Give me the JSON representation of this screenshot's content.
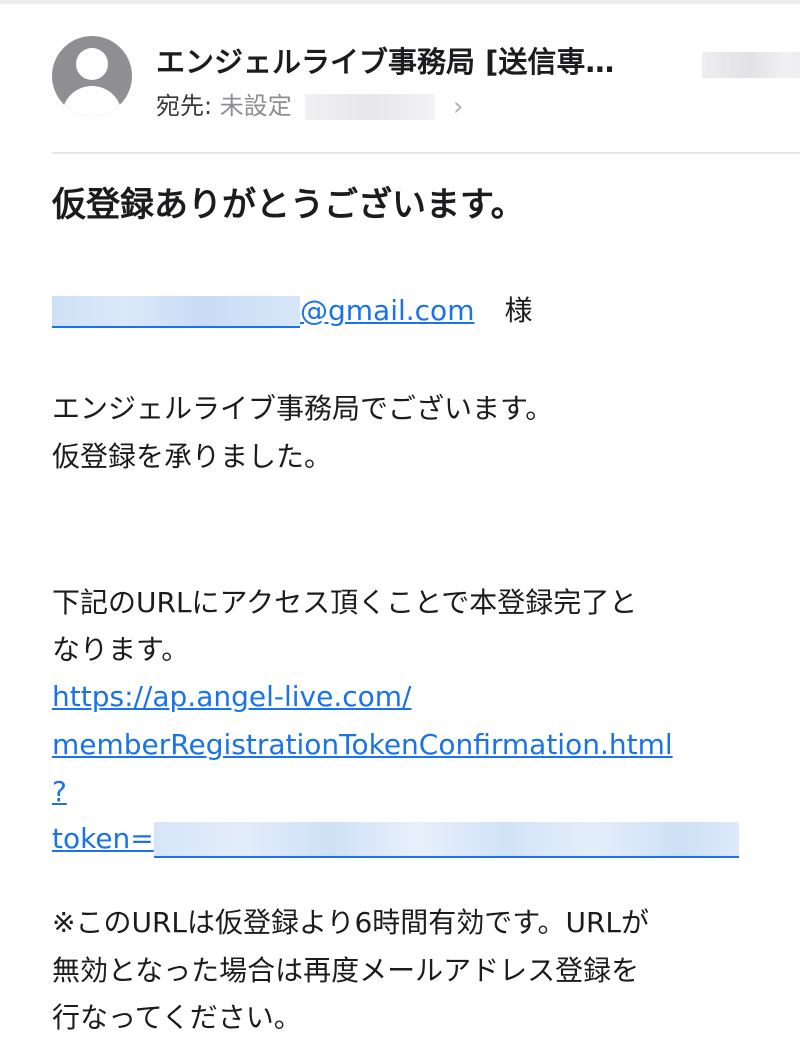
{
  "header": {
    "sender": "エンジェルライブ事務局 [送信専…",
    "to_label": "宛先:",
    "to_value": "未設定",
    "chevron": "›"
  },
  "email": {
    "subject": "仮登録ありがとうございます。",
    "recipient_domain": "@gmail.com",
    "honorific": "様",
    "intro_line1": "エンジェルライブ事務局でございます。",
    "intro_line2": "仮登録を承りました。",
    "instruction_line1": "下記のURLにアクセス頂くことで本登録完了と",
    "instruction_line2": "なります。",
    "url_line1": "https://ap.angel-live.com/",
    "url_line2": "memberRegistrationTokenConfirmation.html",
    "url_line3": "?",
    "url_token_prefix": "token=",
    "note_line1": "※このURLは仮登録より6時間有効です。URLが",
    "note_line2": "無効となった場合は再度メールアドレス登録を",
    "note_line3": "行なってください。"
  },
  "colors": {
    "link": "#1a73e8",
    "avatar": "#8e8e93"
  },
  "icons": {
    "avatar": "person-avatar-icon",
    "chevron": "chevron-right-icon"
  }
}
